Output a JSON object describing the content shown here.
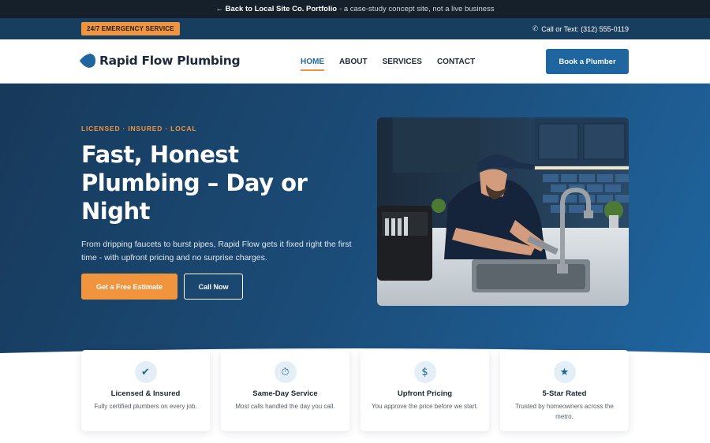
{
  "portfolio_bar": {
    "link_label": "← Back to Local Site Co. Portfolio",
    "text": "- a case-study concept site, not a live business"
  },
  "topbar": {
    "emergency_label": "24/7 EMERGENCY SERVICE",
    "phone_icon": "phone-icon",
    "phone_text": "Call or Text: (312) 555-0119"
  },
  "header": {
    "logo_text": "Rapid Flow Plumbing",
    "nav": [
      {
        "label": "HOME",
        "active": true
      },
      {
        "label": "ABOUT",
        "active": false
      },
      {
        "label": "SERVICES",
        "active": false
      },
      {
        "label": "CONTACT",
        "active": false
      }
    ],
    "cta_label": "Book a Plumber"
  },
  "hero": {
    "eyebrow": "LICENSED · INSURED · LOCAL",
    "title": "Fast, Honest Plumbing – Day or Night",
    "subtitle": "From dripping faucets to burst pipes, Rapid Flow gets it fixed right the first time - with upfront pricing and no surprise charges.",
    "primary_button": "Get a Free Estimate",
    "secondary_button": "Call Now"
  },
  "features": [
    {
      "icon": "checkmark-icon",
      "glyph": "✔",
      "title": "Licensed & Insured",
      "desc": "Fully certified plumbers on every job."
    },
    {
      "icon": "stopwatch-icon",
      "glyph": "⏱",
      "title": "Same-Day Service",
      "desc": "Most calls handled the day you call."
    },
    {
      "icon": "dollar-icon",
      "glyph": "$",
      "title": "Upfront Pricing",
      "desc": "You approve the price before we start."
    },
    {
      "icon": "star-icon",
      "glyph": "★",
      "title": "5-Star Rated",
      "desc": "Trusted by homeowners across the metro."
    }
  ],
  "colors": {
    "brand_blue": "#1f66a1",
    "accent_orange": "#f1943e",
    "dark_navy": "#15202b"
  }
}
